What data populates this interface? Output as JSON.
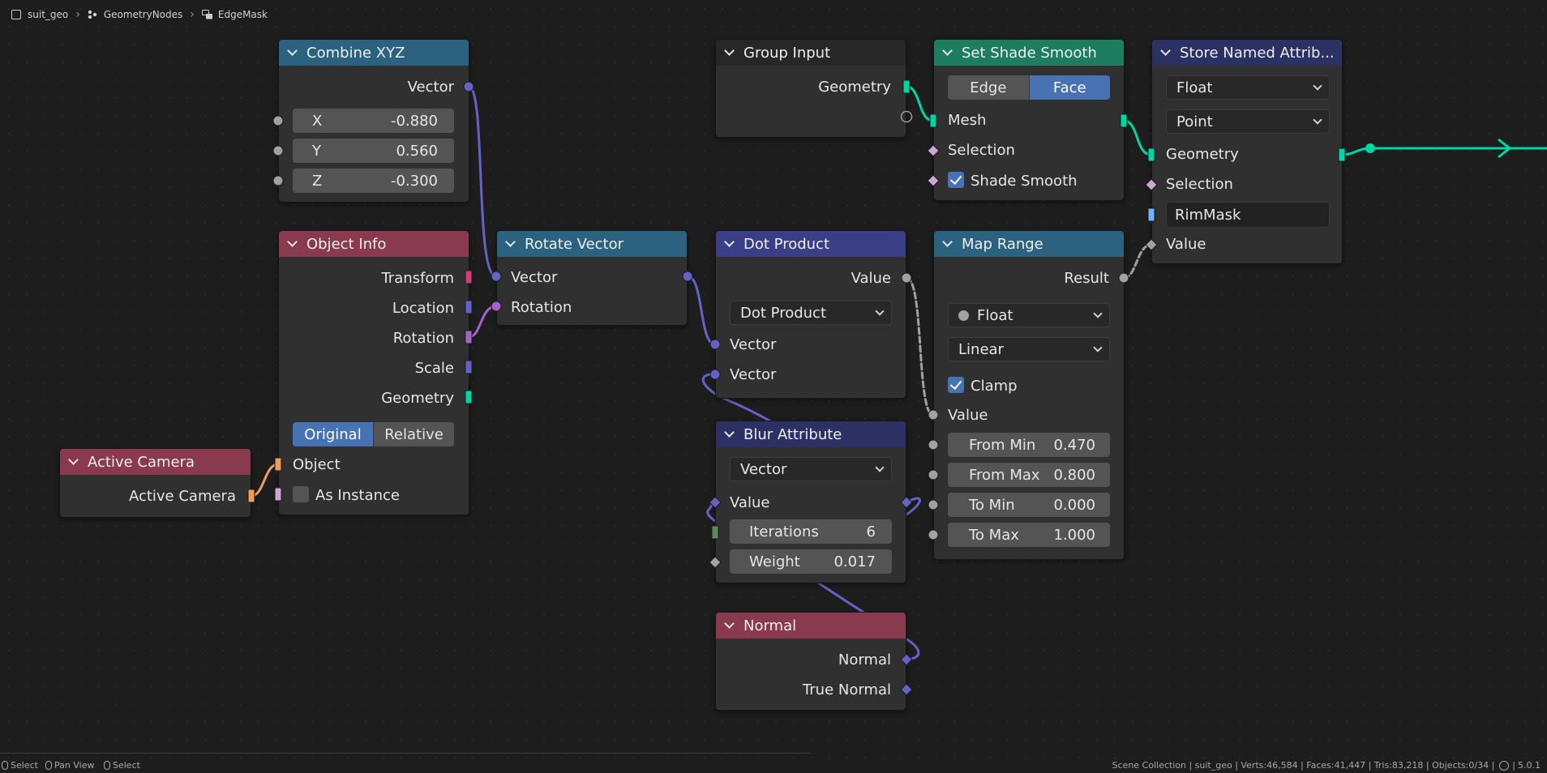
{
  "breadcrumb": {
    "items": [
      {
        "label": "suit_geo",
        "icon": "object-icon"
      },
      {
        "label": "GeometryNodes",
        "icon": "node-tree-icon"
      },
      {
        "label": "EdgeMask",
        "icon": "node-group-icon"
      }
    ]
  },
  "colors": {
    "vector_socket": "#6363c7",
    "float_socket": "#a1a1a1",
    "geometry_socket": "#00d6a3",
    "rotation_socket": "#a663c7",
    "object_socket": "#ed9e5c",
    "integer_socket": "#598c5c",
    "string_socket": "#70b2ff",
    "matrix_socket": "#ce3f77",
    "bool_socket": "#cca6d6",
    "header_vector": "#2b627f",
    "header_input": "#8a3a4f",
    "header_utility": "#3a3e87",
    "header_geometry": "#1c7d5f",
    "header_attribute": "#2b3163",
    "header_group": "#272727",
    "accent": "#4772b3"
  },
  "nodes": {
    "combine_xyz": {
      "title": "Combine XYZ",
      "output_vector": "Vector",
      "x": {
        "label": "X",
        "value": "-0.880"
      },
      "y": {
        "label": "Y",
        "value": "0.560"
      },
      "z": {
        "label": "Z",
        "value": "-0.300"
      }
    },
    "object_info": {
      "title": "Object Info",
      "outputs": [
        "Transform",
        "Location",
        "Rotation",
        "Scale",
        "Geometry"
      ],
      "mode_original": "Original",
      "mode_relative": "Relative",
      "input_object": "Object",
      "input_as_instance": "As Instance"
    },
    "active_camera": {
      "title": "Active Camera",
      "output": "Active Camera"
    },
    "rotate_vector": {
      "title": "Rotate Vector",
      "input_vector": "Vector",
      "input_rotation": "Rotation"
    },
    "group_input": {
      "title": "Group Input",
      "output_geometry": "Geometry"
    },
    "dot_product": {
      "title": "Dot Product",
      "output_value": "Value",
      "operation": "Dot Product",
      "input_a": "Vector",
      "input_b": "Vector"
    },
    "blur_attribute": {
      "title": "Blur Attribute",
      "data_type": "Vector",
      "value": "Value",
      "iterations": {
        "label": "Iterations",
        "value": "6"
      },
      "weight": {
        "label": "Weight",
        "value": "0.017"
      }
    },
    "normal": {
      "title": "Normal",
      "output_normal": "Normal",
      "output_true_normal": "True Normal"
    },
    "set_shade_smooth": {
      "title": "Set Shade Smooth",
      "domain_edge": "Edge",
      "domain_face": "Face",
      "input_mesh": "Mesh",
      "input_selection": "Selection",
      "input_shade_smooth": "Shade Smooth"
    },
    "map_range": {
      "title": "Map Range",
      "output_result": "Result",
      "data_type": "Float",
      "interpolation": "Linear",
      "clamp": "Clamp",
      "input_value": "Value",
      "from_min": {
        "label": "From Min",
        "value": "0.470"
      },
      "from_max": {
        "label": "From Max",
        "value": "0.800"
      },
      "to_min": {
        "label": "To Min",
        "value": "0.000"
      },
      "to_max": {
        "label": "To Max",
        "value": "1.000"
      }
    },
    "store_named_attribute": {
      "title": "Store Named Attrib...",
      "data_type": "Float",
      "domain": "Point",
      "input_geometry": "Geometry",
      "input_selection": "Selection",
      "name": "RimMask",
      "input_value": "Value"
    }
  },
  "statusbar": {
    "hints": [
      {
        "label": "Select"
      },
      {
        "label": "Pan View"
      },
      {
        "label": "Select"
      }
    ],
    "info": "Scene Collection | suit_geo | Verts:46,584 | Faces:41,447 | Tris:83,218 | Objects:0/34 |",
    "version": "5.0.1"
  }
}
